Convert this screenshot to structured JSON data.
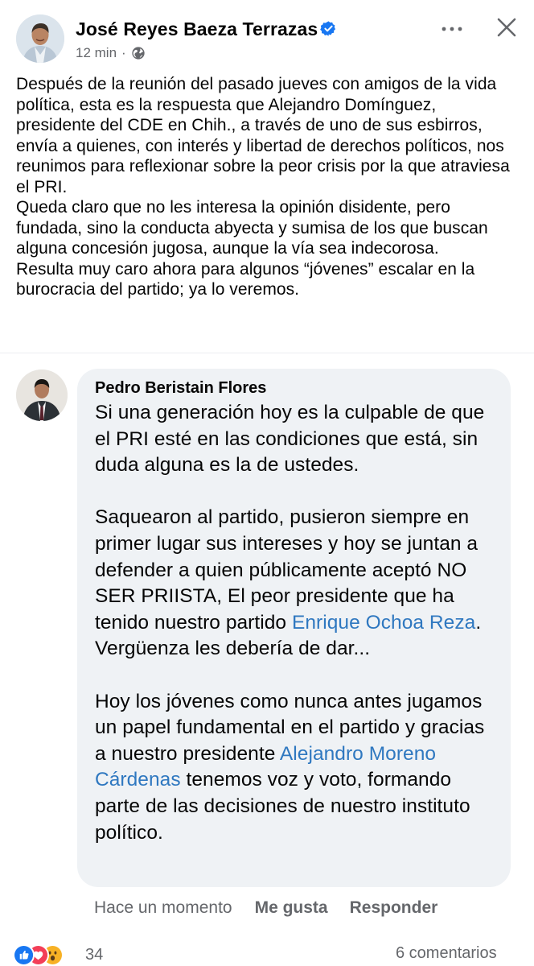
{
  "post": {
    "author": "José Reyes Baeza Terrazas",
    "time": "12 min",
    "separator": "·",
    "body": [
      "Después de la reunión del pasado jueves con amigos de la vida política, esta es la respuesta que Alejandro Domínguez, presidente del CDE en Chih., a través de uno de sus esbirros, envía a quienes, con interés y libertad de derechos políticos, nos reunimos para reflexionar sobre la peor crisis por la que atraviesa el PRI.",
      "Queda claro que no les interesa la opinión disidente, pero fundada, sino la conducta abyecta y sumisa de los que buscan alguna concesión jugosa, aunque la vía sea indecorosa.",
      "Resulta muy caro ahora para algunos “jóvenes” escalar en la burocracia del partido; ya lo veremos."
    ]
  },
  "comment": {
    "author": "Pedro Beristain Flores",
    "p1": "Si una generación hoy es la culpable de que el PRI esté en las condiciones que está, sin duda alguna es la de ustedes.",
    "p2_before": "Saquearon al partido, pusieron siempre en primer lugar sus intereses y hoy se juntan a defender a quien públicamente aceptó NO SER PRIISTA, El peor presidente que ha tenido nuestro partido ",
    "p2_mention": "Enrique Ochoa Reza",
    "p2_after": ". Vergüenza les debería de dar...",
    "p3_before": "Hoy los jóvenes como nunca antes jugamos un papel fundamental en el partido y gracias a nuestro presidente ",
    "p3_mention": "Alejandro Moreno Cárdenas",
    "p3_after": " tenemos voz y voto, formando parte de las decisiones de nuestro instituto político.",
    "time": "Hace un momento",
    "like_label": "Me gusta",
    "reply_label": "Responder"
  },
  "footer": {
    "reaction_count": "34",
    "comments_label": "6 comentarios"
  },
  "icons": {
    "verified": "verified-badge-icon",
    "globe": "globe-icon",
    "more": "more-options-icon",
    "close": "close-icon",
    "like": "like-reaction-icon",
    "love": "love-reaction-icon",
    "wow": "wow-reaction-icon"
  },
  "colors": {
    "facebook_blue": "#1877f2",
    "mention_blue": "#2f78c0",
    "secondary_text": "#65676b",
    "bubble_background": "#eff2f5",
    "love_red": "#f33e58",
    "wow_yellow": "#f7b125"
  }
}
